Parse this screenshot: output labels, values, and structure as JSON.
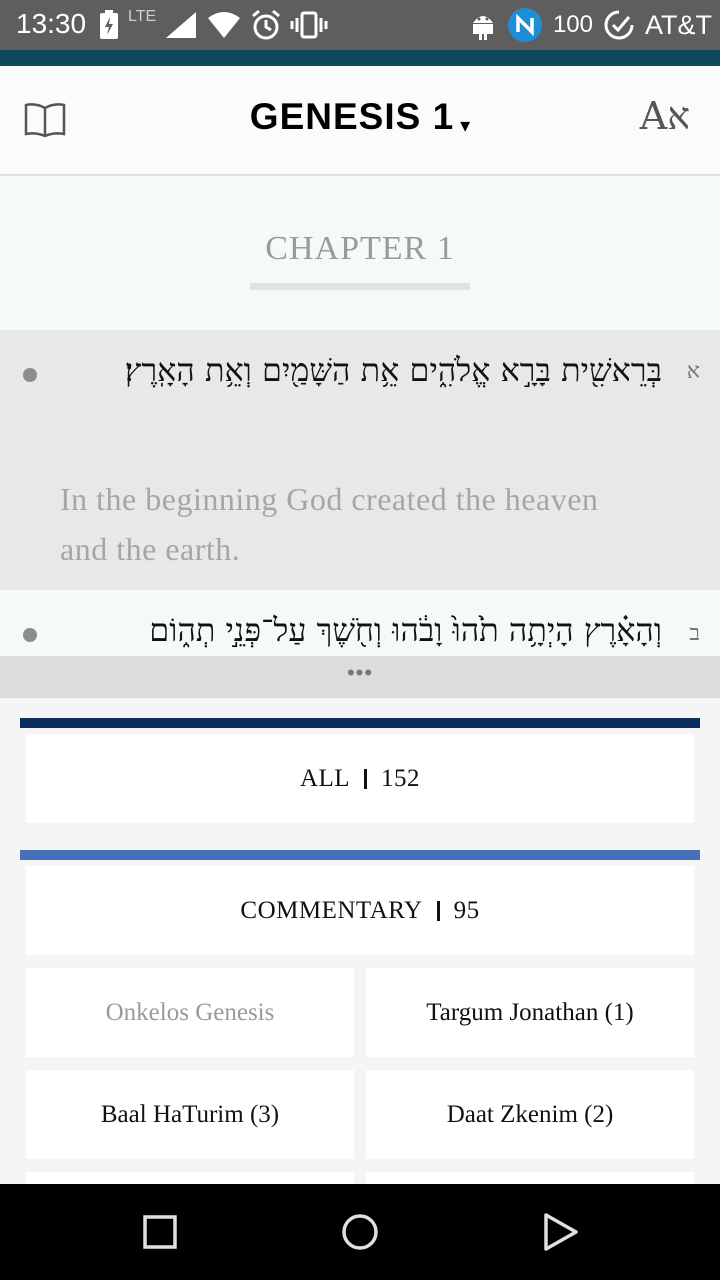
{
  "status_bar": {
    "time": "13:30",
    "network": "LTE",
    "battery": "100",
    "carrier": "AT&T",
    "icons": [
      "battery-saver-icon",
      "signal-icon",
      "wifi-icon",
      "alarm-icon",
      "vibrate-icon",
      "android-icon",
      "sync-badge-icon",
      "data-saver-icon"
    ]
  },
  "header": {
    "title": "GENESIS 1",
    "caret": "▾",
    "font_toggle": "Aא",
    "book_icon": "book-icon"
  },
  "chapter": {
    "title": "CHAPTER 1"
  },
  "verses": [
    {
      "number": "א",
      "hebrew": "בְּרֵאשִׁ֖ית בָּרָ֣א אֱלֹהִ֑ים אֵ֥ת הַשָּׁמַ֖יִם וְאֵ֥ת הָאָֽרֶץ׃",
      "english": "In the beginning God created the heaven and the earth."
    },
    {
      "number": "ב",
      "hebrew": "וְהָאָ֗רֶץ הָיְתָ֥ה תֹ֙הוּ֙ וָבֹ֔הוּ וְחֹ֖שֶׁךְ עַל־פְּנֵ֣י תְה֑וֹם"
    }
  ],
  "drag_handle": "•••",
  "connections": {
    "all": {
      "label": "ALL",
      "count": "152"
    },
    "commentary": {
      "label": "COMMENTARY",
      "count": "95"
    },
    "books": [
      "Onkelos Genesis",
      "Targum Jonathan (1)",
      "Baal HaTurim (3)",
      "Daat Zkenim (2)"
    ]
  },
  "nav_bar": {
    "icons": [
      "back-icon",
      "home-icon",
      "recents-icon"
    ]
  },
  "colors": {
    "status_bar": "#5e5e5e",
    "accent_teal": "#0e4a5c",
    "all_bar": "#0a2e5e",
    "commentary_bar": "#4670b8",
    "chapter_bg": "#f4faf6",
    "selected_verse_bg": "#e8e8e8"
  }
}
